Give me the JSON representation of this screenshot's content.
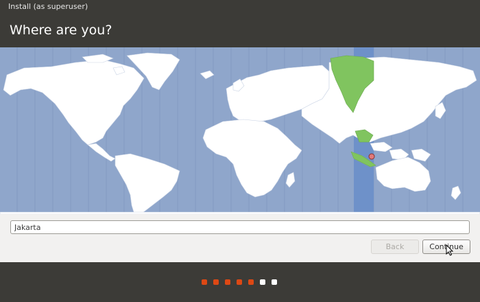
{
  "window": {
    "title": "Install (as superuser)"
  },
  "page": {
    "heading": "Where are you?"
  },
  "map": {
    "ocean_color": "#8fa6cb",
    "land_color": "#ffffff",
    "selected_zone_color": "#6e91c9",
    "highlighted_region_color": "#80c45f",
    "marker_color": "#e07a7a"
  },
  "timezone": {
    "value": "Jakarta"
  },
  "buttons": {
    "back": {
      "label": "Back",
      "enabled": false
    },
    "continue": {
      "label": "Continue",
      "enabled": true
    }
  },
  "progress": {
    "accent": "#dd4814",
    "steps": [
      true,
      true,
      true,
      true,
      true,
      false,
      false
    ]
  }
}
